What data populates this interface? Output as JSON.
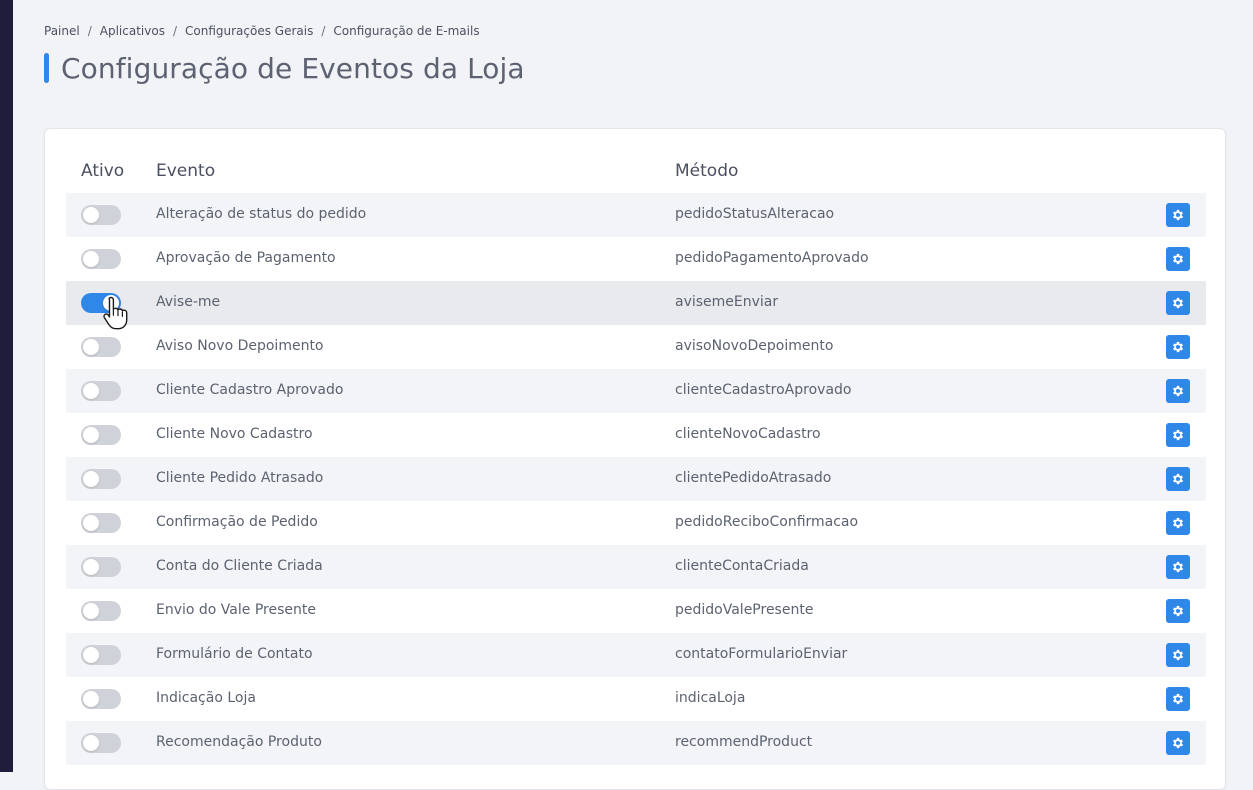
{
  "colors": {
    "accent": "#2f87e8",
    "sidebar": "#1f1d3b",
    "toggle_off": "#cfd2d8"
  },
  "breadcrumb": [
    {
      "label": "Painel"
    },
    {
      "label": "Aplicativos"
    },
    {
      "label": "Configurações Gerais"
    },
    {
      "label": "Configuração de E-mails"
    }
  ],
  "breadcrumb_separator": "/",
  "page_title": "Configuração de Eventos da Loja",
  "table": {
    "headers": {
      "ativo": "Ativo",
      "evento": "Evento",
      "metodo": "Método"
    },
    "rows": [
      {
        "evento": "Alteração de status do pedido",
        "metodo": "pedidoStatusAlteracao",
        "ativo": false
      },
      {
        "evento": "Aprovação de Pagamento",
        "metodo": "pedidoPagamentoAprovado",
        "ativo": false
      },
      {
        "evento": "Avise-me",
        "metodo": "avisemeEnviar",
        "ativo": true
      },
      {
        "evento": "Aviso Novo Depoimento",
        "metodo": "avisoNovoDepoimento",
        "ativo": false
      },
      {
        "evento": "Cliente Cadastro Aprovado",
        "metodo": "clienteCadastroAprovado",
        "ativo": false
      },
      {
        "evento": "Cliente Novo Cadastro",
        "metodo": "clienteNovoCadastro",
        "ativo": false
      },
      {
        "evento": "Cliente Pedido Atrasado",
        "metodo": "clientePedidoAtrasado",
        "ativo": false
      },
      {
        "evento": "Confirmação de Pedido",
        "metodo": "pedidoReciboConfirmacao",
        "ativo": false
      },
      {
        "evento": "Conta do Cliente Criada",
        "metodo": "clienteContaCriada",
        "ativo": false
      },
      {
        "evento": "Envio do Vale Presente",
        "metodo": "pedidoValePresente",
        "ativo": false
      },
      {
        "evento": "Formulário de Contato",
        "metodo": "contatoFormularioEnviar",
        "ativo": false
      },
      {
        "evento": "Indicação Loja",
        "metodo": "indicaLoja",
        "ativo": false
      },
      {
        "evento": "Recomendação Produto",
        "metodo": "recommendProduct",
        "ativo": false
      }
    ]
  },
  "row_action_icon": "gear-icon",
  "hovered_row": 2
}
